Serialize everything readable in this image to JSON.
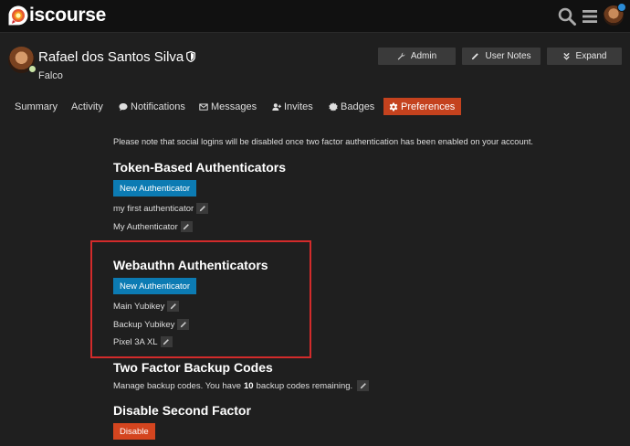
{
  "header": {
    "logo_text": "iscourse",
    "icons": [
      "search-icon",
      "hamburger-icon",
      "user-avatar"
    ]
  },
  "profile": {
    "name": "Rafael dos Santos Silva",
    "title": "Falco",
    "buttons": {
      "admin": "Admin",
      "user_notes": "User Notes",
      "expand": "Expand"
    }
  },
  "nav": {
    "tabs": [
      {
        "label": "Summary",
        "icon": null
      },
      {
        "label": "Activity",
        "icon": null
      },
      {
        "label": "Notifications",
        "icon": "comment-icon"
      },
      {
        "label": "Messages",
        "icon": "envelope-icon"
      },
      {
        "label": "Invites",
        "icon": "user-plus-icon"
      },
      {
        "label": "Badges",
        "icon": "certificate-icon"
      },
      {
        "label": "Preferences",
        "icon": "gear-icon",
        "active": true
      }
    ]
  },
  "content": {
    "note": "Please note that social logins will be disabled once two factor authentication has been enabled on your account.",
    "token": {
      "heading": "Token-Based Authenticators",
      "button": "New Authenticator",
      "items": [
        "my first authenticator",
        "My Authenticator"
      ]
    },
    "webauthn": {
      "heading": "Webauthn Authenticators",
      "button": "New Authenticator",
      "items": [
        "Main Yubikey",
        "Backup Yubikey",
        "Pixel 3A XL"
      ]
    },
    "backup": {
      "heading": "Two Factor Backup Codes",
      "text_before": "Manage backup codes. You have",
      "count": "10",
      "text_after": "backup codes remaining."
    },
    "disable": {
      "heading": "Disable Second Factor",
      "button": "Disable"
    }
  },
  "colors": {
    "background": "#1f1f1f",
    "header": "#111111",
    "primary_blue": "#0c7bb3",
    "danger": "#d4451f",
    "active_tab": "#c4421e",
    "highlight_border": "#d32b2b"
  }
}
